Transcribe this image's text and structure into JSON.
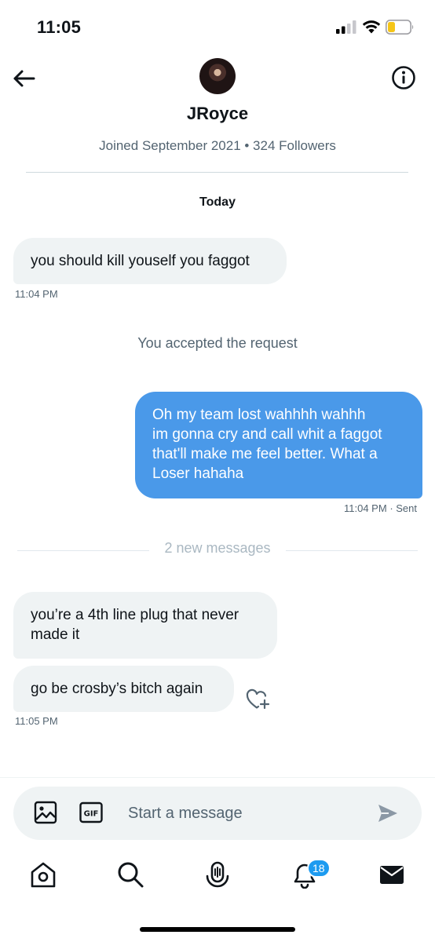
{
  "status_bar": {
    "time": "11:05"
  },
  "header": {
    "name": "JRoyce",
    "meta": "Joined September 2021 • 324 Followers"
  },
  "conversation": {
    "day_label": "Today",
    "messages": [
      {
        "direction": "incoming",
        "text": "you should kill youself you faggot",
        "time": "11:04 PM"
      },
      {
        "direction": "outgoing",
        "lines": [
          "Oh my team lost wahhhh wahhh",
          "im gonna cry and call whit a faggot",
          "that'll make me feel better. What a",
          "Loser hahaha"
        ],
        "time": "11:04 PM",
        "status": "· Sent"
      },
      {
        "direction": "incoming",
        "lines": [
          "you’re a 4th line plug that never",
          "made it"
        ]
      },
      {
        "direction": "incoming",
        "text": "go be crosby’s bitch again",
        "time": "11:05 PM"
      }
    ],
    "system_note": "You accepted the request",
    "new_messages_divider": "2 new messages"
  },
  "composer": {
    "placeholder": "Start a message",
    "icons": [
      "image-icon",
      "gif-icon",
      "send-icon"
    ]
  },
  "tab_bar": {
    "tabs": [
      "home-icon",
      "search-icon",
      "spaces-icon",
      "notifications-icon",
      "messages-icon"
    ],
    "notifications_badge": "18"
  },
  "colors": {
    "accent": "#1d9bf0",
    "outgoing_bubble": "#4a99e9",
    "incoming_bubble": "#eff3f4",
    "secondary_text": "#536471"
  }
}
